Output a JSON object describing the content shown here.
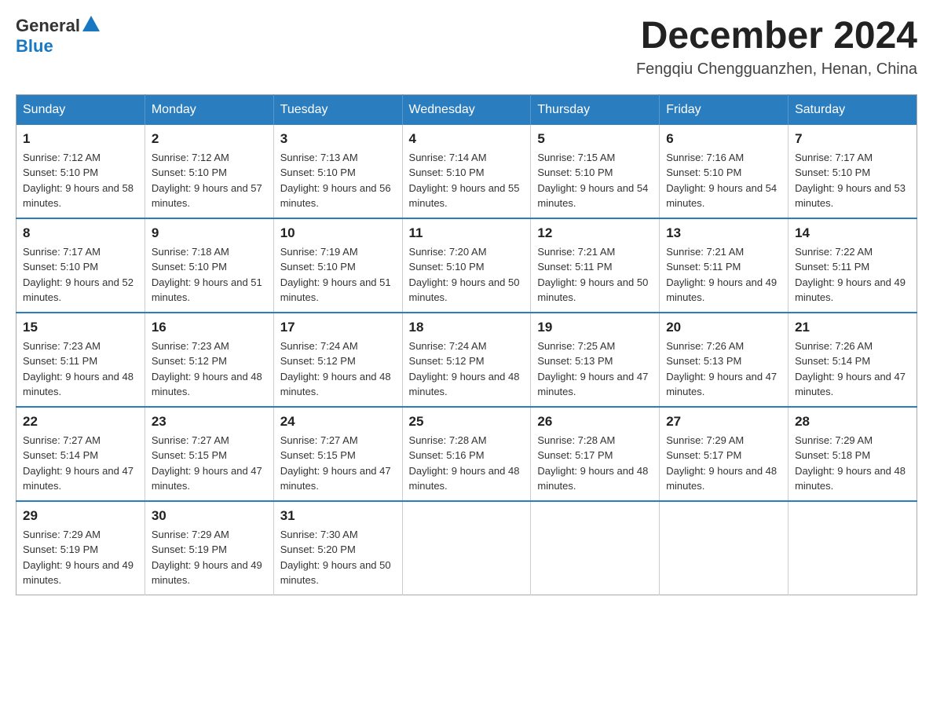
{
  "header": {
    "logo": {
      "general": "General",
      "blue": "Blue"
    },
    "title": "December 2024",
    "location": "Fengqiu Chengguanzhen, Henan, China"
  },
  "weekdays": [
    "Sunday",
    "Monday",
    "Tuesday",
    "Wednesday",
    "Thursday",
    "Friday",
    "Saturday"
  ],
  "weeks": [
    [
      {
        "day": "1",
        "sunrise": "7:12 AM",
        "sunset": "5:10 PM",
        "daylight": "9 hours and 58 minutes."
      },
      {
        "day": "2",
        "sunrise": "7:12 AM",
        "sunset": "5:10 PM",
        "daylight": "9 hours and 57 minutes."
      },
      {
        "day": "3",
        "sunrise": "7:13 AM",
        "sunset": "5:10 PM",
        "daylight": "9 hours and 56 minutes."
      },
      {
        "day": "4",
        "sunrise": "7:14 AM",
        "sunset": "5:10 PM",
        "daylight": "9 hours and 55 minutes."
      },
      {
        "day": "5",
        "sunrise": "7:15 AM",
        "sunset": "5:10 PM",
        "daylight": "9 hours and 54 minutes."
      },
      {
        "day": "6",
        "sunrise": "7:16 AM",
        "sunset": "5:10 PM",
        "daylight": "9 hours and 54 minutes."
      },
      {
        "day": "7",
        "sunrise": "7:17 AM",
        "sunset": "5:10 PM",
        "daylight": "9 hours and 53 minutes."
      }
    ],
    [
      {
        "day": "8",
        "sunrise": "7:17 AM",
        "sunset": "5:10 PM",
        "daylight": "9 hours and 52 minutes."
      },
      {
        "day": "9",
        "sunrise": "7:18 AM",
        "sunset": "5:10 PM",
        "daylight": "9 hours and 51 minutes."
      },
      {
        "day": "10",
        "sunrise": "7:19 AM",
        "sunset": "5:10 PM",
        "daylight": "9 hours and 51 minutes."
      },
      {
        "day": "11",
        "sunrise": "7:20 AM",
        "sunset": "5:10 PM",
        "daylight": "9 hours and 50 minutes."
      },
      {
        "day": "12",
        "sunrise": "7:21 AM",
        "sunset": "5:11 PM",
        "daylight": "9 hours and 50 minutes."
      },
      {
        "day": "13",
        "sunrise": "7:21 AM",
        "sunset": "5:11 PM",
        "daylight": "9 hours and 49 minutes."
      },
      {
        "day": "14",
        "sunrise": "7:22 AM",
        "sunset": "5:11 PM",
        "daylight": "9 hours and 49 minutes."
      }
    ],
    [
      {
        "day": "15",
        "sunrise": "7:23 AM",
        "sunset": "5:11 PM",
        "daylight": "9 hours and 48 minutes."
      },
      {
        "day": "16",
        "sunrise": "7:23 AM",
        "sunset": "5:12 PM",
        "daylight": "9 hours and 48 minutes."
      },
      {
        "day": "17",
        "sunrise": "7:24 AM",
        "sunset": "5:12 PM",
        "daylight": "9 hours and 48 minutes."
      },
      {
        "day": "18",
        "sunrise": "7:24 AM",
        "sunset": "5:12 PM",
        "daylight": "9 hours and 48 minutes."
      },
      {
        "day": "19",
        "sunrise": "7:25 AM",
        "sunset": "5:13 PM",
        "daylight": "9 hours and 47 minutes."
      },
      {
        "day": "20",
        "sunrise": "7:26 AM",
        "sunset": "5:13 PM",
        "daylight": "9 hours and 47 minutes."
      },
      {
        "day": "21",
        "sunrise": "7:26 AM",
        "sunset": "5:14 PM",
        "daylight": "9 hours and 47 minutes."
      }
    ],
    [
      {
        "day": "22",
        "sunrise": "7:27 AM",
        "sunset": "5:14 PM",
        "daylight": "9 hours and 47 minutes."
      },
      {
        "day": "23",
        "sunrise": "7:27 AM",
        "sunset": "5:15 PM",
        "daylight": "9 hours and 47 minutes."
      },
      {
        "day": "24",
        "sunrise": "7:27 AM",
        "sunset": "5:15 PM",
        "daylight": "9 hours and 47 minutes."
      },
      {
        "day": "25",
        "sunrise": "7:28 AM",
        "sunset": "5:16 PM",
        "daylight": "9 hours and 48 minutes."
      },
      {
        "day": "26",
        "sunrise": "7:28 AM",
        "sunset": "5:17 PM",
        "daylight": "9 hours and 48 minutes."
      },
      {
        "day": "27",
        "sunrise": "7:29 AM",
        "sunset": "5:17 PM",
        "daylight": "9 hours and 48 minutes."
      },
      {
        "day": "28",
        "sunrise": "7:29 AM",
        "sunset": "5:18 PM",
        "daylight": "9 hours and 48 minutes."
      }
    ],
    [
      {
        "day": "29",
        "sunrise": "7:29 AM",
        "sunset": "5:19 PM",
        "daylight": "9 hours and 49 minutes."
      },
      {
        "day": "30",
        "sunrise": "7:29 AM",
        "sunset": "5:19 PM",
        "daylight": "9 hours and 49 minutes."
      },
      {
        "day": "31",
        "sunrise": "7:30 AM",
        "sunset": "5:20 PM",
        "daylight": "9 hours and 50 minutes."
      },
      null,
      null,
      null,
      null
    ]
  ]
}
